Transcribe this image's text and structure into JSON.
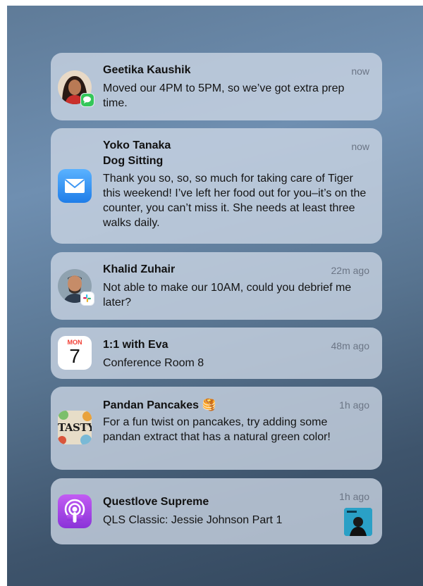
{
  "notifications": [
    {
      "title": "Geetika Kaushik",
      "time": "now",
      "body": "Moved our 4PM to 5PM, so we’ve got extra prep time.",
      "icon": "person-avatar-messages-badge"
    },
    {
      "title": "Yoko Tanaka",
      "subtitle": "Dog Sitting",
      "time": "now",
      "body": "Thank you so, so, so much for taking care of Tiger this weekend! I’ve left her food out for you–it’s on the counter, you can’t miss it. She needs at least three walks daily.",
      "icon": "mail-icon"
    },
    {
      "title": "Khalid Zuhair",
      "time": "22m ago",
      "body": "Not able to make our 10AM, could you debrief me later?",
      "icon": "person-avatar-slack-badge"
    },
    {
      "title": "1:1 with Eva",
      "time": "48m ago",
      "body": "Conference Room 8",
      "icon": "calendar-icon",
      "calendar": {
        "month": "MON",
        "day": "7"
      }
    },
    {
      "title": "Pandan Pancakes",
      "title_emoji": "🥞",
      "time": "1h ago",
      "body": "For a fun twist on pancakes, try adding some pandan extract that has a natural green color!",
      "icon": "tasty-icon",
      "brand": "TASTY"
    },
    {
      "title": "Questlove Supreme",
      "time": "1h ago",
      "body": "QLS Classic: Jessie Johnson Part 1",
      "icon": "podcasts-icon"
    }
  ],
  "colors": {
    "mail_blue": "#2f8ff5",
    "podcast_purple": "#a24ee6",
    "message_green": "#34c759"
  }
}
